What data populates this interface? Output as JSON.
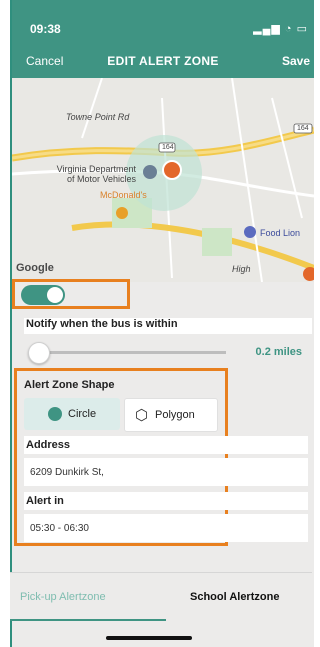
{
  "status": {
    "time": "09:38",
    "icons": "▂▄▆ ◔ ▭"
  },
  "header": {
    "cancel": "Cancel",
    "title": "EDIT ALERT ZONE",
    "save": "Save"
  },
  "map": {
    "labels": {
      "street": "Towne Point Rd",
      "dmv": "Virginia Department\nof Motor Vehicles",
      "mcdonalds": "McDonald's",
      "foodlion": "Food Lion",
      "hwy164": "164",
      "hwy164b": "164",
      "highway": "High"
    },
    "attribution": "Google"
  },
  "toggle": {
    "on": true
  },
  "notify_label": "Notify when the bus is within",
  "slider": {
    "value": "0.2 miles",
    "level": 0.08
  },
  "shape": {
    "label": "Alert Zone Shape",
    "options": [
      "Circle",
      "Polygon"
    ],
    "selected": "Circle"
  },
  "address": {
    "label": "Address",
    "value": "6209 Dunkirk St,"
  },
  "alert_in": {
    "label": "Alert in",
    "value": "05:30 - 06:30"
  },
  "tabs": {
    "pickup": "Pick-up Alertzone",
    "school": "School Alertzone",
    "active": "pickup"
  },
  "colors": {
    "accent": "#3f9483",
    "highlight": "#e8801f",
    "marker": "#e3672a"
  }
}
